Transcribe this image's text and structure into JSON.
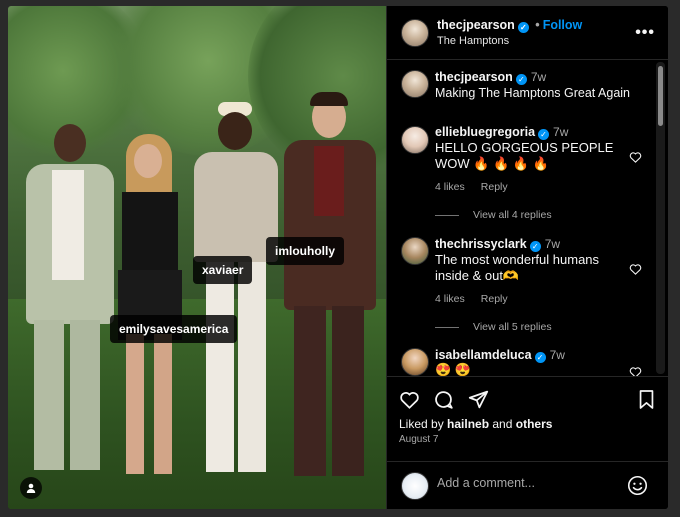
{
  "post": {
    "username": "thecjpearson",
    "follow_label": "Follow",
    "separator": "•",
    "location": "The Hamptons",
    "more_label": "•••"
  },
  "photo_tags": [
    {
      "label": "xaviaer"
    },
    {
      "label": "imlouholly"
    },
    {
      "label": "emilysavesamerica"
    }
  ],
  "caption": {
    "username": "thecjpearson",
    "time": "7w",
    "text": "Making The Hamptons Great Again"
  },
  "comments": [
    {
      "username": "elliebluegregoria",
      "time": "7w",
      "text": "HELLO GORGEOUS PEOPLE WOW 🔥 🔥 🔥 🔥",
      "likes": "4 likes",
      "reply": "Reply",
      "view_replies": "View all 4 replies"
    },
    {
      "username": "thechrissyclark",
      "time": "7w",
      "text": "The most wonderful humans inside & out🫶",
      "likes": "4 likes",
      "reply": "Reply",
      "view_replies": "View all 5 replies"
    },
    {
      "username": "isabellamdeluca",
      "time": "7w",
      "text": "😍 😍"
    }
  ],
  "likes_line": {
    "prefix": "Liked by ",
    "user": "hailneb",
    "middle": " and ",
    "others": "others"
  },
  "date": "August 7",
  "add_comment_placeholder": "Add a comment...",
  "icons": [
    "heart-icon",
    "comment-icon",
    "share-icon",
    "bookmark-icon",
    "emoji-icon",
    "more-options-icon",
    "user-tag-icon",
    "verified-badge-icon"
  ],
  "colors": {
    "accent": "#0095f6",
    "verified": "#0095f6",
    "background": "#000000",
    "muted": "#a8a8a8"
  }
}
